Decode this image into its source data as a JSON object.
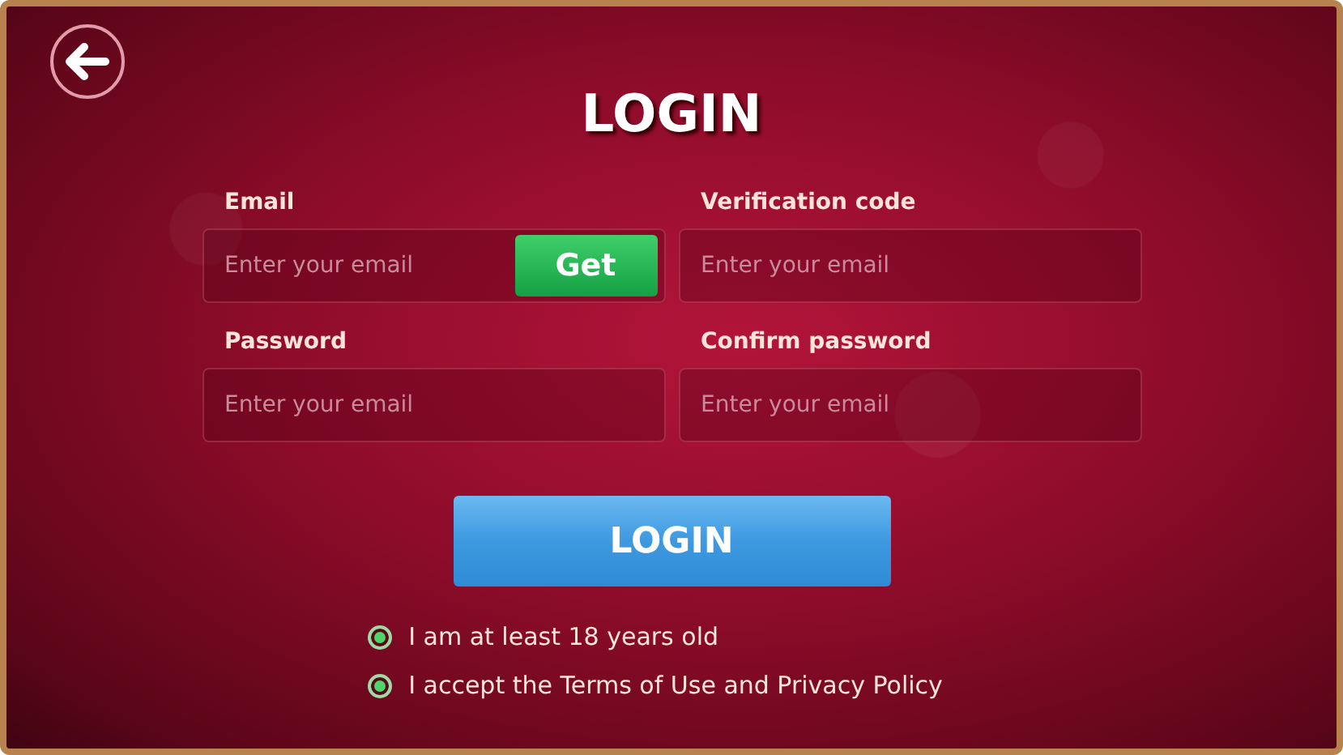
{
  "title": "LOGIN",
  "fields": [
    {
      "label": "Email",
      "placeholder": "Enter your email",
      "action": "Get"
    },
    {
      "label": "Verification code",
      "placeholder": "Enter your email"
    },
    {
      "label": "Password",
      "placeholder": "Enter your email"
    },
    {
      "label": "Confirm password",
      "placeholder": "Enter your email"
    }
  ],
  "submit": "LOGIN",
  "agreements": [
    {
      "label": "I am at least 18 years old",
      "checked": true
    },
    {
      "label": "I accept the Terms of Use and Privacy Policy",
      "checked": true
    }
  ]
}
